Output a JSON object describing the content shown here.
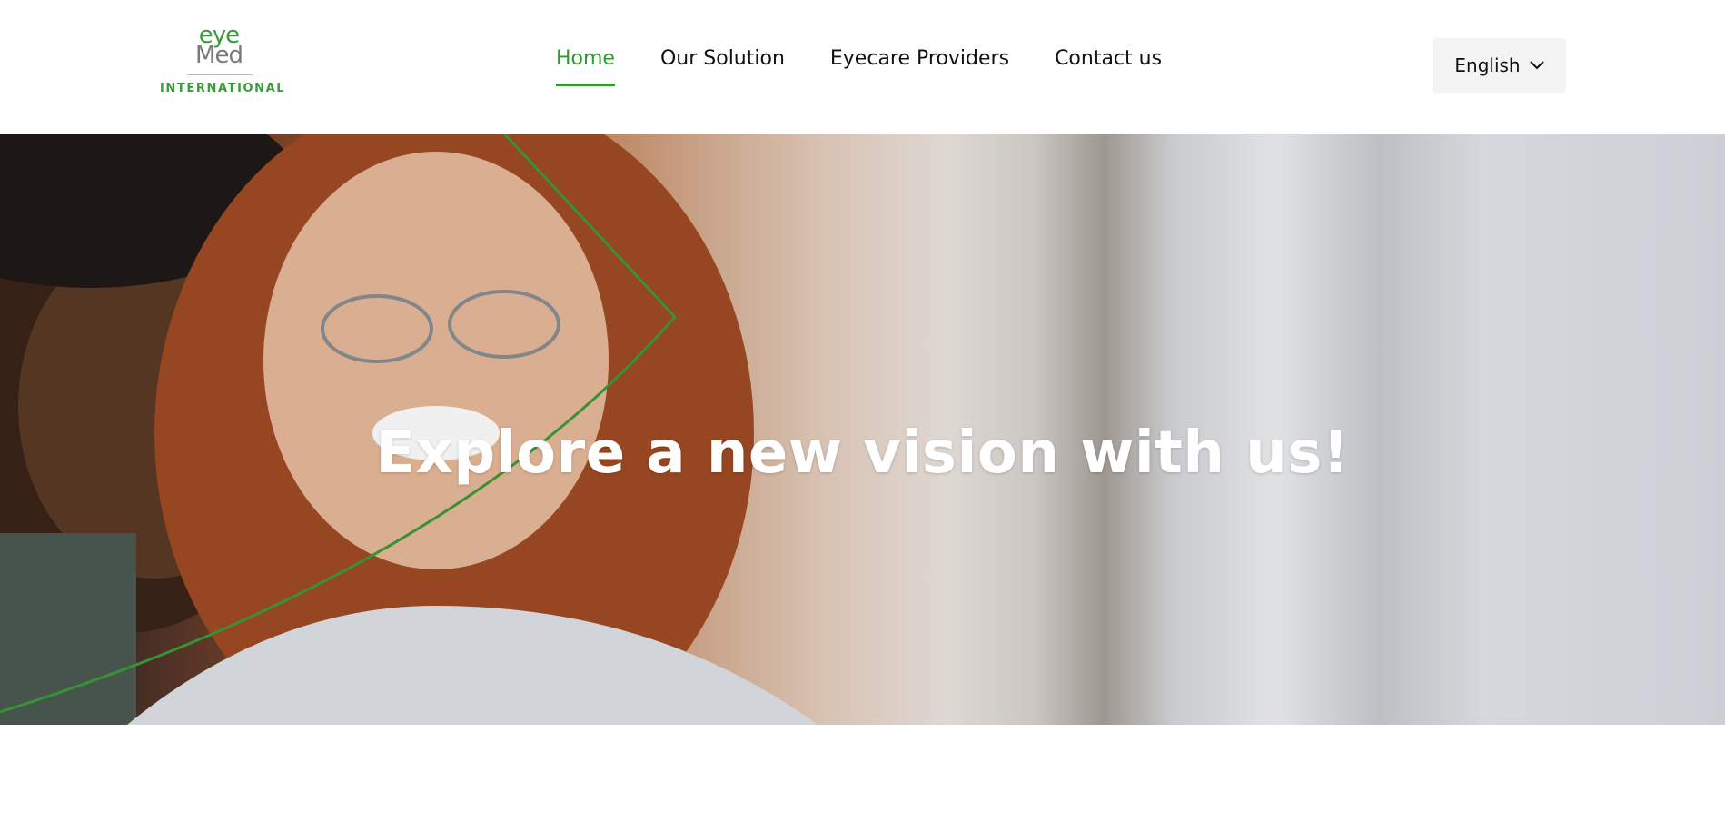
{
  "brand": {
    "logo_top": "eye",
    "logo_bottom": "Med",
    "logo_sub": "INTERNATIONAL",
    "accent_color": "#2f9a2f"
  },
  "nav": {
    "items": [
      {
        "label": "Home",
        "active": true
      },
      {
        "label": "Our Solution",
        "active": false
      },
      {
        "label": "Eyecare Providers",
        "active": false
      },
      {
        "label": "Contact us",
        "active": false
      }
    ]
  },
  "language": {
    "selected": "English",
    "icon": "chevron-down-icon"
  },
  "hero": {
    "title": "Explore a new vision with us!",
    "image": "couple-smiling-photo"
  }
}
